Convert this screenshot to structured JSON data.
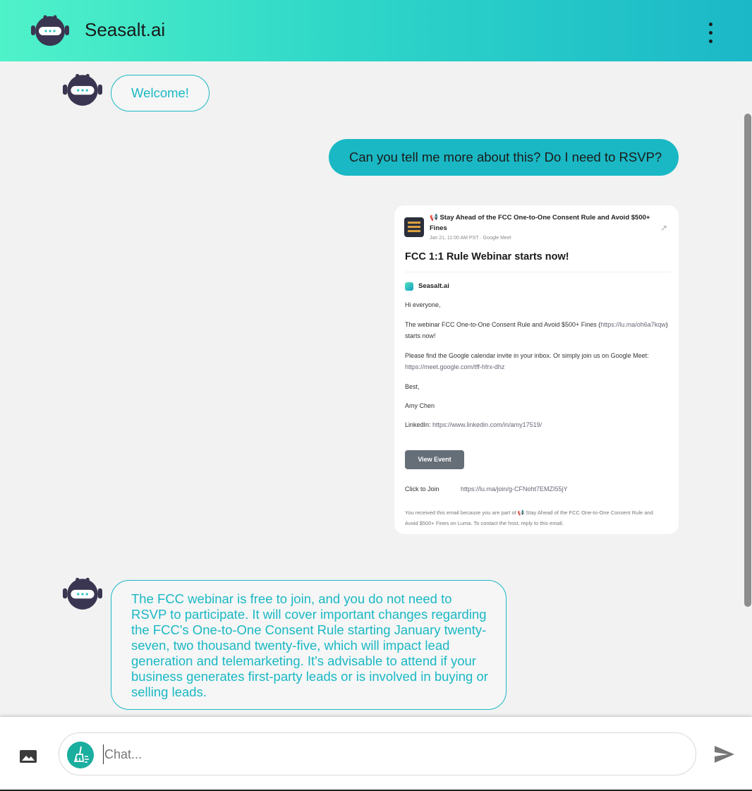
{
  "app": {
    "title": "Seasalt.ai",
    "logo_icon": "robot-icon",
    "menu_icon": "kebab-menu-icon",
    "accent_color": "#1ab8c4"
  },
  "messages": {
    "welcome": "Welcome!",
    "user_question": "Can you tell me more about this? Do I need to RSVP?",
    "bot_reply": "The FCC webinar is free to join, and you do not need to RSVP to participate. It will cover important changes regarding the FCC's One-to-One Consent Rule starting January twenty-seven, two thousand twenty-five, which will impact lead generation and telemarketing. It's advisable to attend if your business generates first-party leads or is involved in buying or selling leads."
  },
  "attachment": {
    "event_title": "📢 Stay Ahead of the FCC One-to-One Consent Rule and Avoid $500+ Fines",
    "event_meta": "Jan 21, 11:00 AM PST · Google Meet",
    "heading": "FCC 1:1 Rule Webinar starts now!",
    "brand": "Seasalt.ai",
    "greeting": "Hi everyone,",
    "para1_text": "The webinar FCC One-to-One Consent Rule and Avoid $500+ Fines (",
    "para1_link": "https://lu.ma/oh6a7kqw",
    "para1_end": ") starts now!",
    "para2_text": "Please find the Google calendar invite in your inbox. Or simply join us on Google Meet: ",
    "para2_link": "https://meet.google.com/tff-hfrx-dhz",
    "signoff": "Best,",
    "signer": "Amy Chen",
    "linkedin_label": "LinkedIn: ",
    "linkedin_link": "https://www.linkedin.com/in/amy17519/",
    "button": "View Event",
    "join_label": "Click to Join",
    "join_link": "https://lu.ma/join/g-CFNoht7EMZI55jY",
    "footer": "You received this email because you are part of 📢 Stay Ahead of the FCC One-to-One Consent Rule and Avoid $500+ Fines on Luma. To contact the host, reply to this email."
  },
  "composer": {
    "placeholder": "Chat...",
    "image_icon": "image-icon",
    "clear_icon": "broom-icon",
    "send_icon": "send-icon"
  }
}
